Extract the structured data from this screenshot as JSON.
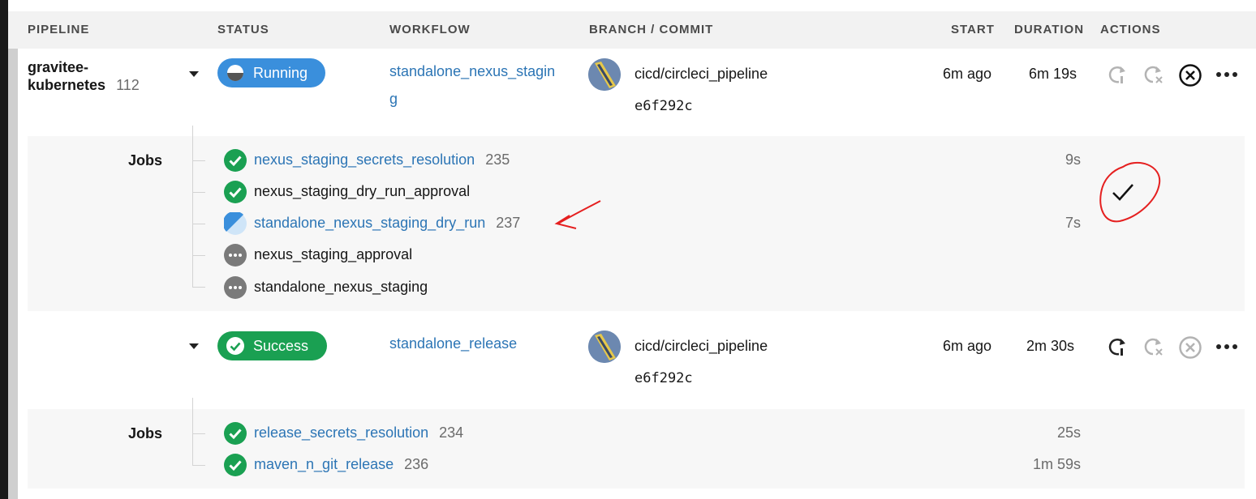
{
  "columns": {
    "pipeline": "PIPELINE",
    "status": "STATUS",
    "workflow": "WORKFLOW",
    "branch_commit": "BRANCH / COMMIT",
    "start": "START",
    "duration": "DURATION",
    "actions": "ACTIONS"
  },
  "pipeline": {
    "name_line1": "gravitee-",
    "name_line2": "kubernetes",
    "number": "112"
  },
  "workflows": [
    {
      "status": "Running",
      "name_line1": "standalone_nexus_stagin",
      "name_line2": "g",
      "branch": "cicd/circleci_pipeline",
      "commit": "e6f292c",
      "start": "6m ago",
      "duration": "6m 19s",
      "jobs_label": "Jobs",
      "jobs": [
        {
          "name": "nexus_staging_secrets_resolution",
          "number": "235",
          "duration": "9s",
          "status": "success"
        },
        {
          "name": "nexus_staging_dry_run_approval",
          "number": "",
          "duration": "",
          "status": "success"
        },
        {
          "name": "standalone_nexus_staging_dry_run",
          "number": "237",
          "duration": "7s",
          "status": "running"
        },
        {
          "name": "nexus_staging_approval",
          "number": "",
          "duration": "",
          "status": "blocked"
        },
        {
          "name": "standalone_nexus_staging",
          "number": "",
          "duration": "",
          "status": "blocked"
        }
      ]
    },
    {
      "status": "Success",
      "name_line1": "standalone_release",
      "branch": "cicd/circleci_pipeline",
      "commit": "e6f292c",
      "start": "6m ago",
      "duration": "2m 30s",
      "jobs_label": "Jobs",
      "jobs": [
        {
          "name": "release_secrets_resolution",
          "number": "234",
          "duration": "25s",
          "status": "success"
        },
        {
          "name": "maven_n_git_release",
          "number": "236",
          "duration": "1m 59s",
          "status": "success"
        }
      ]
    }
  ],
  "colors": {
    "link": "#2c75b5",
    "running": "#3a8fdc",
    "success": "#1aa052",
    "blocked": "#7a7a7a",
    "annotation": "#e52020"
  }
}
